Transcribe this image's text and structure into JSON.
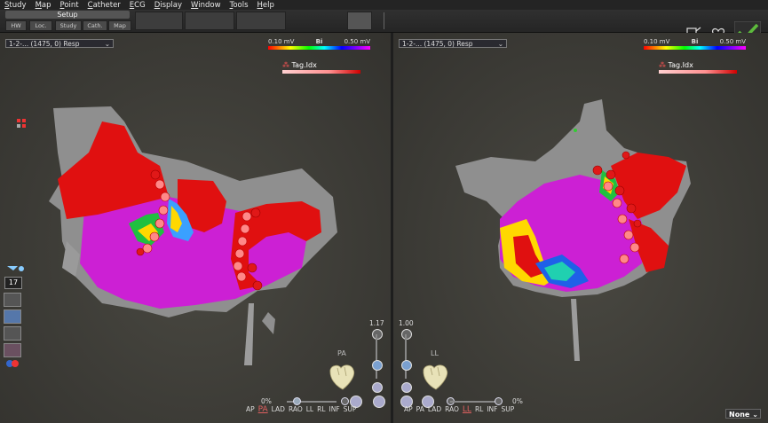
{
  "menu": [
    "Study",
    "Map",
    "Point",
    "Catheter",
    "ECG",
    "Display",
    "Window",
    "Tools",
    "Help"
  ],
  "toolbar": {
    "setup_label": "Setup",
    "buttons": [
      "HW",
      "Loc.",
      "Study",
      "Cath.",
      "Map"
    ]
  },
  "left_view": {
    "map_select": "1-2-... (1475, 0) Resp",
    "scale_min": "0.10 mV",
    "scale_mode": "Bi",
    "scale_max": "0.50 mV",
    "tag_label": "Tag.Idx",
    "zoom": "1.17",
    "view_label": "PA",
    "opacity": "0%",
    "orientations": [
      "AP",
      "PA",
      "LAD",
      "RAO",
      "LL",
      "RL",
      "INF",
      "SUP"
    ],
    "active_orientation": "PA"
  },
  "right_view": {
    "map_select": "1-2-... (1475, 0) Resp",
    "scale_min": "0.10 mV",
    "scale_mode": "Bi",
    "scale_max": "0.50 mV",
    "tag_label": "Tag.Idx",
    "zoom": "1.00",
    "view_label": "LL",
    "opacity": "0%",
    "orientations": [
      "AP",
      "PA",
      "LAD",
      "RAO",
      "LL",
      "RL",
      "INF",
      "SUP"
    ],
    "active_orientation": "LL"
  },
  "left_panel": {
    "number": "17"
  },
  "bottom_right_select": "None",
  "colors": {
    "accent_check": "#5dbb3c",
    "magenta": "#d020d8",
    "red": "#e01010"
  }
}
